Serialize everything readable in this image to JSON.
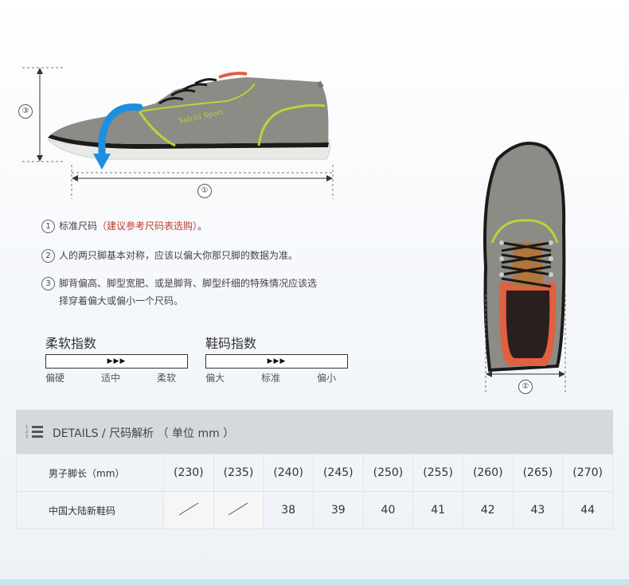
{
  "colors": {
    "accent_red": "#c0392b",
    "header_bg": "#d5d9de",
    "arrow_blue": "#1e8fe0",
    "shoe_gray": "#8c8b85",
    "lime": "#b8d43a"
  },
  "diagram": {
    "height_marker": "③",
    "length_marker": "①",
    "width_marker": "②",
    "brand_text": "Satchi Sport"
  },
  "notes": [
    {
      "num": "1",
      "text": "标准尺码",
      "highlight": "（建议参考尺码表选购）",
      "end": "。"
    },
    {
      "num": "2",
      "text": "人的两只脚基本对称，应该以偏大你那只脚的数据为准。"
    },
    {
      "num": "3",
      "line1": "脚背偏高、脚型宽肥、或是脚背、脚型纤细的特殊情况应该选",
      "line2": "择穿着偏大或偏小一个尺码。"
    }
  ],
  "softness": {
    "title": "柔软指数",
    "arrows": "▶▶▶",
    "labels": [
      "偏硬",
      "适中",
      "柔软"
    ],
    "selected": "适中"
  },
  "fit": {
    "title": "鞋码指数",
    "arrows": "▶▶▶",
    "labels": [
      "偏大",
      "标准",
      "偏小"
    ],
    "selected": "标准"
  },
  "details": {
    "label": "DETAILS / 尺码解析 （ 单位 mm ）",
    "icon": "list-numbered-icon"
  },
  "size_table": {
    "row1_label": "男子脚长（mm）",
    "row2_label": "中国大陆新鞋码",
    "foot_lengths": [
      "(230)",
      "(235)",
      "(240)",
      "(245)",
      "(250)",
      "(255)",
      "(260)",
      "(265)",
      "(270)"
    ],
    "cn_sizes": [
      "",
      "",
      "38",
      "39",
      "40",
      "41",
      "42",
      "43",
      "44"
    ]
  }
}
